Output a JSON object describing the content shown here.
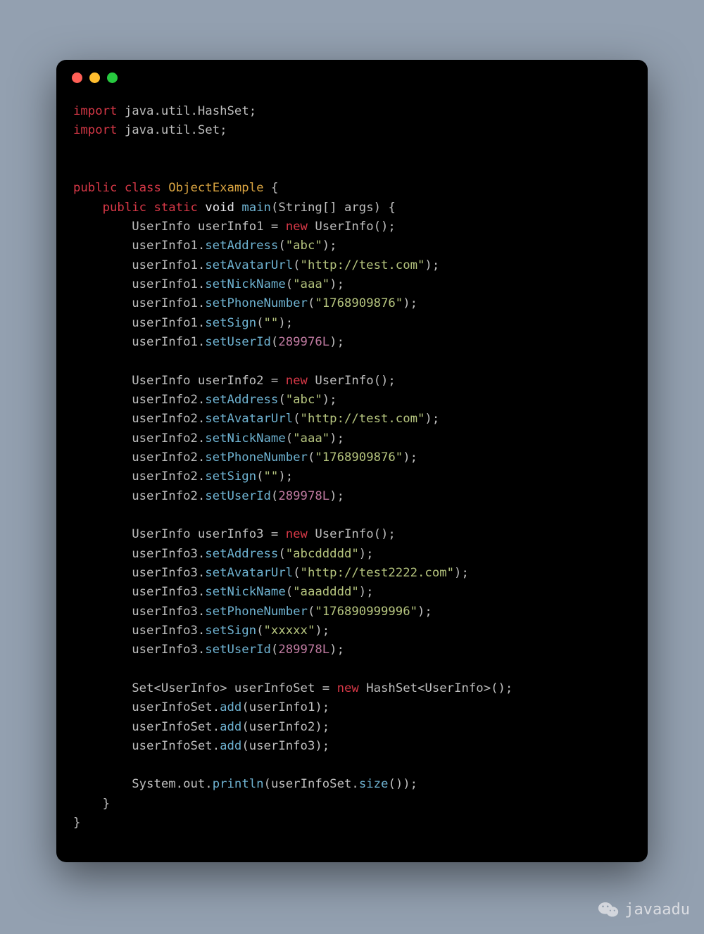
{
  "window": {
    "buttons": [
      "close",
      "minimize",
      "zoom"
    ]
  },
  "code": {
    "imports": [
      {
        "pkg": "java.util",
        "cls": "HashSet"
      },
      {
        "pkg": "java.util",
        "cls": "Set"
      }
    ],
    "class_decl": {
      "mods": "public class",
      "name": "ObjectExample"
    },
    "main_decl": {
      "mods": "public static",
      "ret": "void",
      "name": "main",
      "params": "String[] args"
    },
    "blocks": [
      {
        "decl": {
          "type": "UserInfo",
          "var": "userInfo1",
          "ctor": "UserInfo"
        },
        "calls": [
          {
            "obj": "userInfo1",
            "m": "setAddress",
            "arg_str": "\"abc\""
          },
          {
            "obj": "userInfo1",
            "m": "setAvatarUrl",
            "arg_str": "\"http://test.com\""
          },
          {
            "obj": "userInfo1",
            "m": "setNickName",
            "arg_str": "\"aaa\""
          },
          {
            "obj": "userInfo1",
            "m": "setPhoneNumber",
            "arg_str": "\"1768909876\""
          },
          {
            "obj": "userInfo1",
            "m": "setSign",
            "arg_str": "\"\""
          },
          {
            "obj": "userInfo1",
            "m": "setUserId",
            "arg_num": "289976L"
          }
        ]
      },
      {
        "decl": {
          "type": "UserInfo",
          "var": "userInfo2",
          "ctor": "UserInfo"
        },
        "calls": [
          {
            "obj": "userInfo2",
            "m": "setAddress",
            "arg_str": "\"abc\""
          },
          {
            "obj": "userInfo2",
            "m": "setAvatarUrl",
            "arg_str": "\"http://test.com\""
          },
          {
            "obj": "userInfo2",
            "m": "setNickName",
            "arg_str": "\"aaa\""
          },
          {
            "obj": "userInfo2",
            "m": "setPhoneNumber",
            "arg_str": "\"1768909876\""
          },
          {
            "obj": "userInfo2",
            "m": "setSign",
            "arg_str": "\"\""
          },
          {
            "obj": "userInfo2",
            "m": "setUserId",
            "arg_num": "289978L"
          }
        ]
      },
      {
        "decl": {
          "type": "UserInfo",
          "var": "userInfo3",
          "ctor": "UserInfo"
        },
        "calls": [
          {
            "obj": "userInfo3",
            "m": "setAddress",
            "arg_str": "\"abcddddd\""
          },
          {
            "obj": "userInfo3",
            "m": "setAvatarUrl",
            "arg_str": "\"http://test2222.com\""
          },
          {
            "obj": "userInfo3",
            "m": "setNickName",
            "arg_str": "\"aaadddd\""
          },
          {
            "obj": "userInfo3",
            "m": "setPhoneNumber",
            "arg_str": "\"176890999996\""
          },
          {
            "obj": "userInfo3",
            "m": "setSign",
            "arg_str": "\"xxxxx\""
          },
          {
            "obj": "userInfo3",
            "m": "setUserId",
            "arg_num": "289978L"
          }
        ]
      }
    ],
    "set_decl": {
      "type": "Set",
      "gen": "UserInfo",
      "var": "userInfoSet",
      "ctor": "HashSet",
      "ctor_gen": "UserInfo"
    },
    "set_adds": [
      {
        "obj": "userInfoSet",
        "m": "add",
        "arg_var": "userInfo1"
      },
      {
        "obj": "userInfoSet",
        "m": "add",
        "arg_var": "userInfo2"
      },
      {
        "obj": "userInfoSet",
        "m": "add",
        "arg_var": "userInfo3"
      }
    ],
    "println": {
      "obj": "System",
      "field": "out",
      "m": "println",
      "inner_obj": "userInfoSet",
      "inner_m": "size"
    }
  },
  "watermark": {
    "text": "javaadu"
  }
}
